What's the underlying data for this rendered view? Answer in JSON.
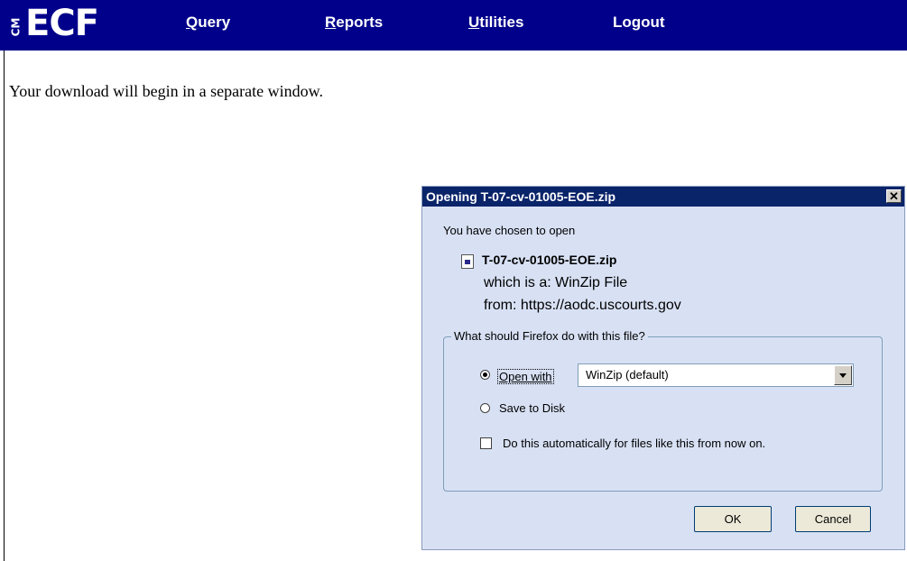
{
  "header": {
    "logo_cm": "CM",
    "logo_ecf": "ECF",
    "nav": [
      {
        "first": "Q",
        "rest": "uery"
      },
      {
        "first": "R",
        "rest": "eports"
      },
      {
        "first": "U",
        "rest": "tilities"
      },
      {
        "first": "",
        "rest": "Logout"
      }
    ]
  },
  "main": {
    "message": "Your download will begin in a separate window."
  },
  "dialog": {
    "title": "Opening T-07-cv-01005-EOE.zip",
    "close_glyph": "✕",
    "chosen_text": "You have chosen to open",
    "file_name": "T-07-cv-01005-EOE.zip",
    "file_type": "which is a:  WinZip File",
    "file_from": "from: https://aodc.uscourts.gov",
    "group_label": "What should Firefox do with this file?",
    "open_with_label": "Open with",
    "open_with_value": "WinZip (default)",
    "save_label": "Save to Disk",
    "auto_label": "Do this automatically for files like this from now on.",
    "ok_label": "OK",
    "cancel_label": "Cancel",
    "open_with_selected": true,
    "auto_checked": false
  },
  "colors": {
    "navbar": "#00008b",
    "dialog_bg": "#d8e1f4",
    "titlebar": "#0a246a"
  }
}
